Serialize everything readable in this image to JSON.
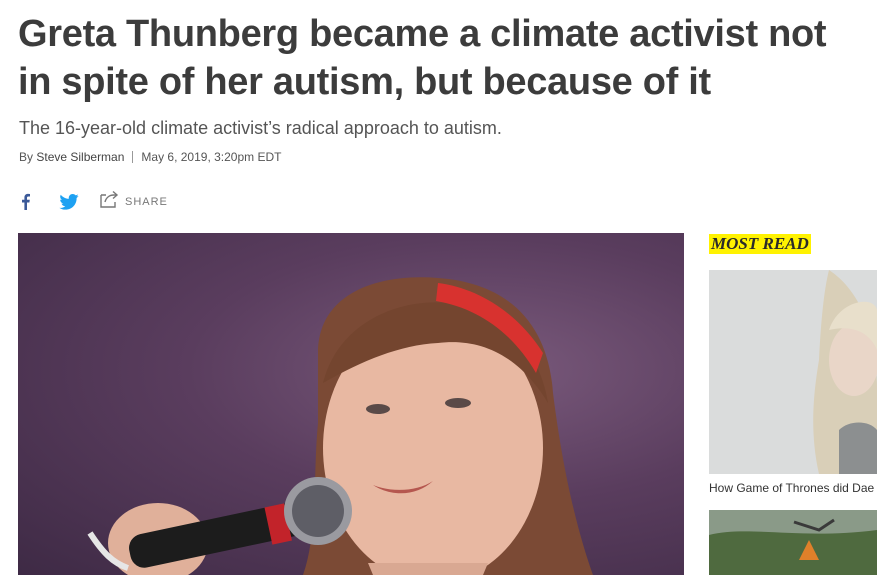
{
  "article": {
    "headline_line1": "Greta Thunberg became a climate activist not",
    "headline_line2": "in spite of her autism, but because of it",
    "dek": "The 16-year-old climate activist’s radical approach to autism.",
    "byline_prefix": "By",
    "author": "Steve Silberman",
    "date": "May 6, 2019, 3:20pm EDT"
  },
  "share": {
    "facebook_icon": "facebook-icon",
    "twitter_icon": "twitter-icon",
    "share_icon": "share-icon",
    "share_label": "SHARE"
  },
  "sidebar": {
    "title": "MOST READ",
    "items": [
      {
        "caption": "How Game of Thrones did Dae"
      }
    ]
  },
  "colors": {
    "headline": "#3c3c3c",
    "highlight": "#fff200",
    "twitter": "#1da1f2",
    "facebook": "#3b5998"
  }
}
